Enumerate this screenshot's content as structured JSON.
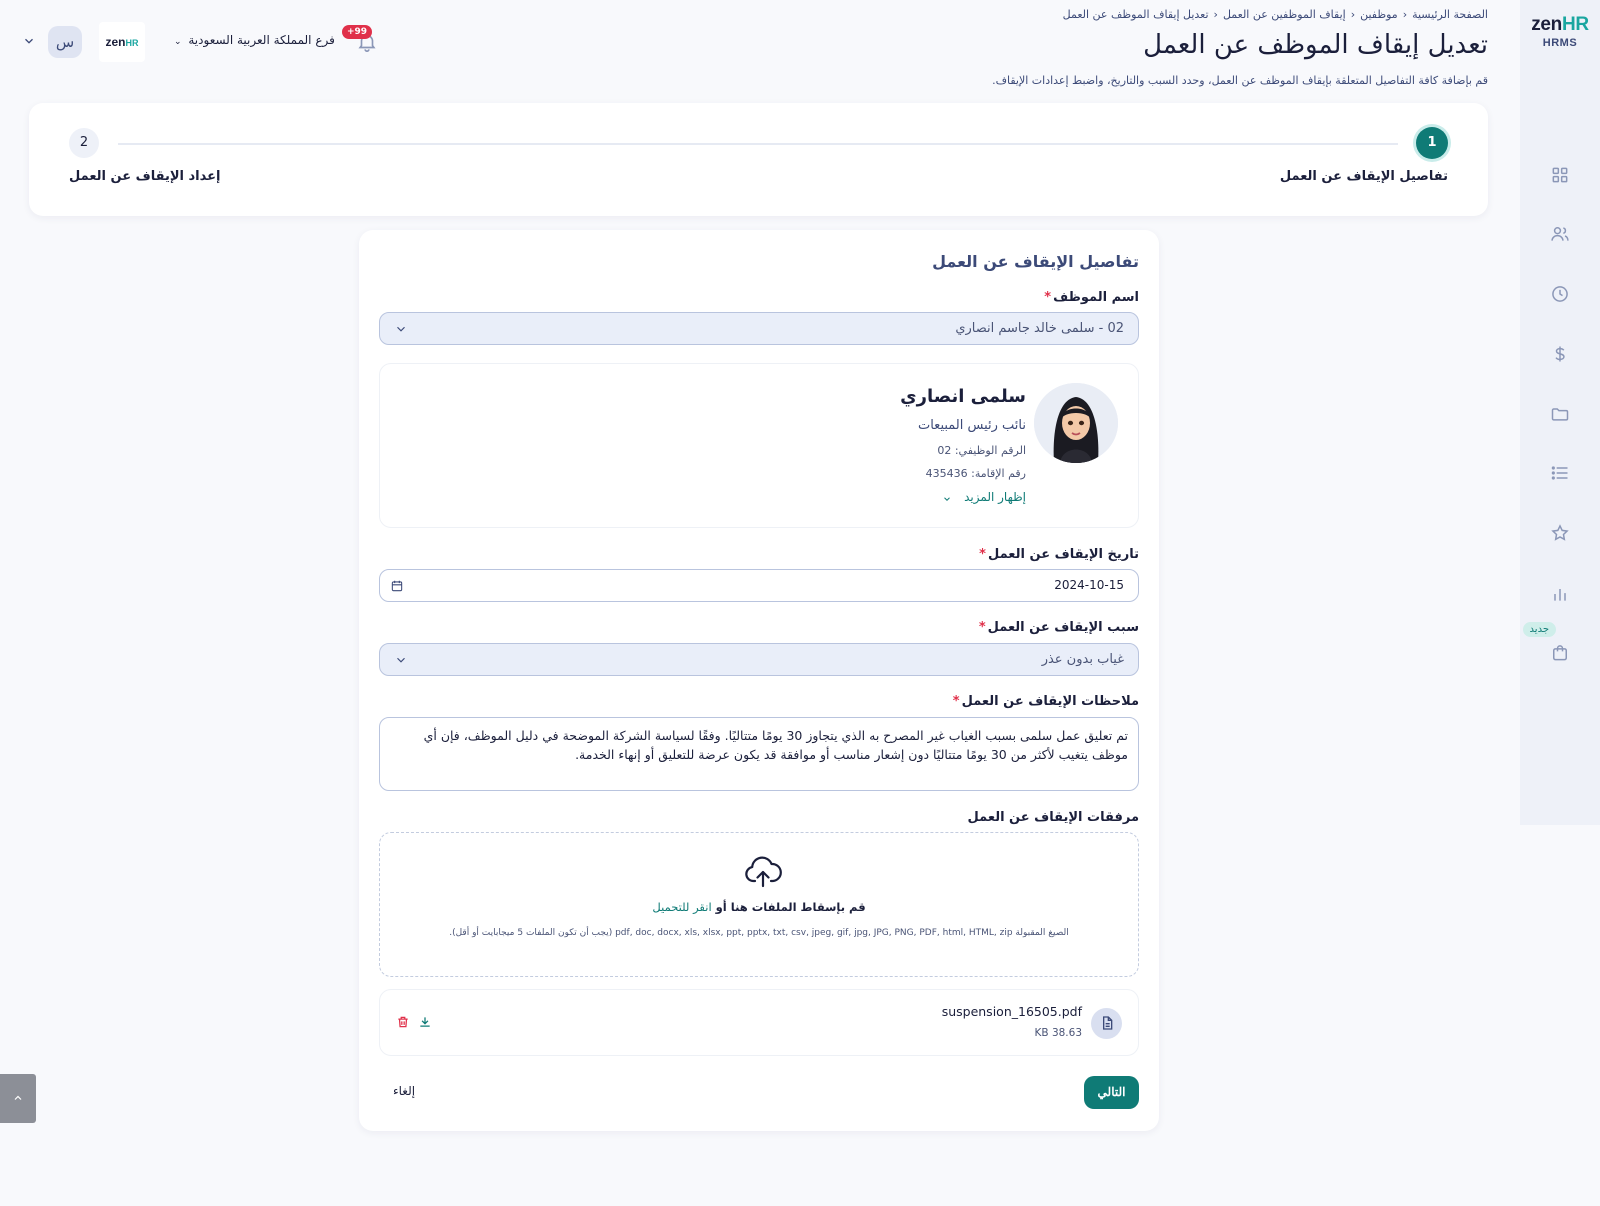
{
  "brand": {
    "logo_zen": "zen",
    "logo_hr": "HR",
    "product": "HRMS"
  },
  "sidebar": {
    "new_badge": "جديد",
    "items": [
      {
        "icon": "dashboard-grid-icon"
      },
      {
        "icon": "users-icon"
      },
      {
        "icon": "clock-icon"
      },
      {
        "icon": "dollar-icon"
      },
      {
        "icon": "folder-icon"
      },
      {
        "icon": "list-icon"
      },
      {
        "icon": "star-icon"
      },
      {
        "icon": "bar-chart-icon"
      },
      {
        "icon": "shopping-bag-icon"
      }
    ]
  },
  "topbar": {
    "user_initial": "س",
    "company_logo_zen": "zen",
    "company_logo_hr": "HR",
    "branch": "فرع المملكة العربية السعودية",
    "notifications_badge": "+99"
  },
  "breadcrumb": {
    "items": [
      "الصفحة الرئيسية",
      "موظفين",
      "إيقاف الموظفين عن العمل",
      "تعديل إيقاف الموظف عن العمل"
    ]
  },
  "page": {
    "title": "تعديل إيقاف الموظف عن العمل",
    "subtitle": "قم بإضافة كافة التفاصيل المتعلقة بإيقاف الموظف عن العمل، وحدد السبب والتاريخ، واضبط إعدادات الإيقاف."
  },
  "stepper": {
    "steps": [
      {
        "number": "1",
        "label": "تفاصيل الإيقاف عن العمل",
        "active": true
      },
      {
        "number": "2",
        "label": "إعداد الإيقاف عن العمل",
        "active": false
      }
    ]
  },
  "form": {
    "section_title": "تفاصيل الإيقاف عن العمل",
    "employee": {
      "label": "اسم الموظف",
      "required_mark": "*",
      "value": "02 - سلمى خالد جاسم انصاري"
    },
    "employee_card": {
      "name": "سلمى انصاري",
      "job_title": "نائب رئيس المبيعات",
      "employee_no": "الرقم الوظيفي: 02",
      "iqama_no": "رقم الإقامة: 435436",
      "show_more": "إظهار المزيد"
    },
    "date": {
      "label": "تاريخ الإيقاف عن العمل",
      "required_mark": "*",
      "value": "2024-10-15"
    },
    "reason": {
      "label": "سبب الإيقاف عن العمل",
      "required_mark": "*",
      "value": "غياب بدون عذر"
    },
    "notes": {
      "label": "ملاحظات الإيقاف عن العمل",
      "required_mark": "*",
      "value": "تم تعليق عمل سلمى بسبب الغياب غير المصرح به الذي يتجاوز 30 يومًا متتاليًا. وفقًا لسياسة الشركة الموضحة في دليل الموظف، فإن أي موظف يتغيب لأكثر من 30 يومًا متتاليًا دون إشعار مناسب أو موافقة قد يكون عرضة للتعليق أو إنهاء الخدمة."
    },
    "attachments": {
      "label": "مرفقات الإيقاف عن العمل",
      "drop_text": "قم بإسقاط الملفات هنا أو",
      "drop_link": "انقر للتحميل",
      "accepted_hint": "الصيغ المقبولة pdf, doc, docx, xls, xlsx, ppt, pptx, txt, csv, jpeg, gif, jpg, JPG, PNG, PDF, html, HTML, zip (يجب أن تكون الملفات 5 ميجابايت أو أقل)."
    },
    "file": {
      "name": "suspension_16505.pdf",
      "size": "38.63 KB"
    },
    "buttons": {
      "next": "التالي",
      "cancel": "إلغاء"
    }
  },
  "colors": {
    "primary": "#0f7b76",
    "brand_accent": "#1aa6a0",
    "danger": "#e0304a",
    "text": "#1b1f3b",
    "muted": "#3c4a78"
  }
}
